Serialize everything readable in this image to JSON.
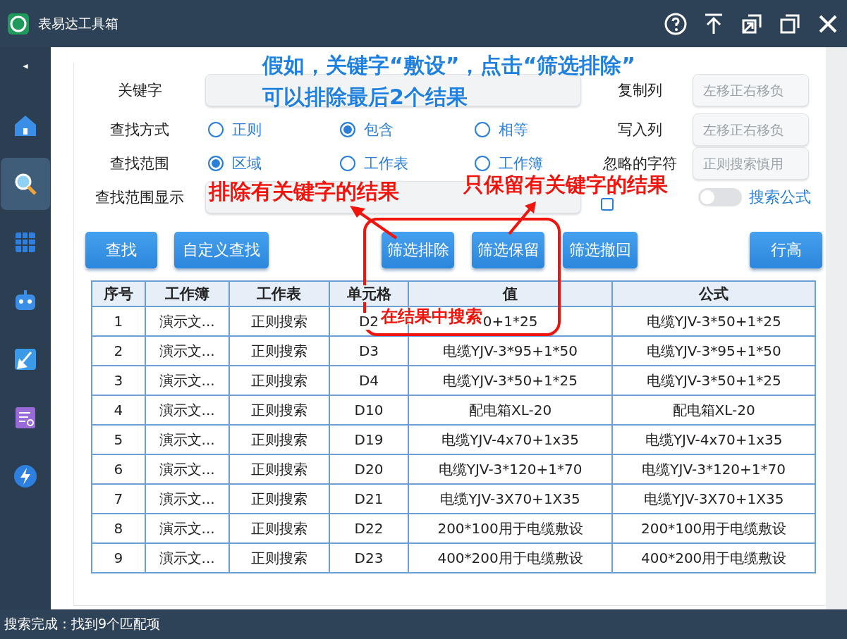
{
  "window": {
    "title": "表易达工具箱"
  },
  "sidebar": {
    "toggle": "◂",
    "items": [
      {
        "kind": "home",
        "selected": false
      },
      {
        "kind": "search",
        "selected": true
      },
      {
        "kind": "grid",
        "selected": false
      },
      {
        "kind": "robot",
        "selected": false
      },
      {
        "kind": "brush",
        "selected": false
      },
      {
        "kind": "report",
        "selected": false
      },
      {
        "kind": "bolt",
        "selected": false
      }
    ]
  },
  "form": {
    "keyword": {
      "label": "关键字"
    },
    "method": {
      "label": "查找方式",
      "options": [
        {
          "label": "正则",
          "selected": false
        },
        {
          "label": "包含",
          "selected": true
        },
        {
          "label": "相等",
          "selected": false
        }
      ]
    },
    "scope": {
      "label": "查找范围",
      "options": [
        {
          "label": "区域",
          "selected": true
        },
        {
          "label": "工作表",
          "selected": false
        },
        {
          "label": "工作簿",
          "selected": false
        }
      ]
    },
    "scope_display": {
      "label": "查找范围显示"
    }
  },
  "side_fields": [
    {
      "label": "复制列",
      "placeholder": "左移正右移负"
    },
    {
      "label": "写入列",
      "placeholder": "左移正右移负"
    },
    {
      "label": "忽略的字符",
      "placeholder": "正则搜索慎用"
    }
  ],
  "lock_last": {
    "checked": false
  },
  "formula_search": {
    "label": "搜索公式",
    "on": false
  },
  "buttons": [
    {
      "label": "查找"
    },
    {
      "label": "自定义查找"
    },
    {
      "label": "筛选排除"
    },
    {
      "label": "筛选保留"
    },
    {
      "label": "筛选撤回"
    },
    {
      "label": "行高"
    }
  ],
  "table": {
    "columns": [
      "序号",
      "工作簿",
      "工作表",
      "单元格",
      "值",
      "公式"
    ],
    "rows": [
      [
        "1",
        "演示文...",
        "正则搜索",
        "D2",
        "0+1*25",
        "电缆YJV-3*50+1*25"
      ],
      [
        "2",
        "演示文...",
        "正则搜索",
        "D3",
        "电缆YJV-3*95+1*50",
        "电缆YJV-3*95+1*50"
      ],
      [
        "3",
        "演示文...",
        "正则搜索",
        "D4",
        "电缆YJV-3*50+1*25",
        "电缆YJV-3*50+1*25"
      ],
      [
        "4",
        "演示文...",
        "正则搜索",
        "D10",
        "配电箱XL-20",
        "配电箱XL-20"
      ],
      [
        "5",
        "演示文...",
        "正则搜索",
        "D19",
        "电缆YJV-4x70+1x35",
        "电缆YJV-4x70+1x35"
      ],
      [
        "6",
        "演示文...",
        "正则搜索",
        "D20",
        "电缆YJV-3*120+1*70",
        "电缆YJV-3*120+1*70"
      ],
      [
        "7",
        "演示文...",
        "正则搜索",
        "D21",
        "电缆YJV-3X70+1X35",
        "电缆YJV-3X70+1X35"
      ],
      [
        "8",
        "演示文...",
        "正则搜索",
        "D22",
        "200*100用于电缆敷设",
        "200*100用于电缆敷设"
      ],
      [
        "9",
        "演示文...",
        "正则搜索",
        "D23",
        "400*200用于电缆敷设",
        "400*200用于电缆敷设"
      ]
    ]
  },
  "status_bar": "搜索完成：找到9个匹配项",
  "annotations": {
    "note": [
      "假如，关键字“敷设”，点击“筛选排除”",
      "可以排除最后2个结果"
    ],
    "exclude_label": "排除有关键字的结果",
    "keep_label": "只保留有关键字的结果",
    "frame_label": "在结果中搜索"
  }
}
